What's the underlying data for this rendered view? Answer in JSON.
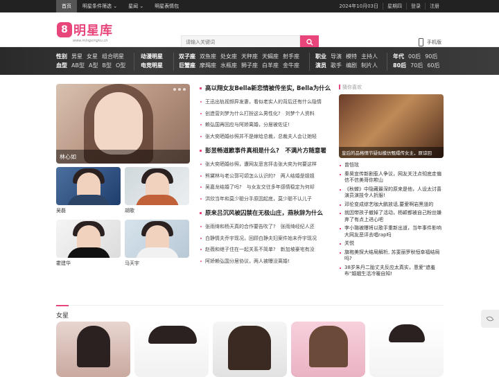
{
  "topbar": {
    "nav": [
      "首页",
      "明星条件筛选 ⌄",
      "星闻 ⌄",
      "明星表情包"
    ],
    "date": "2024年10月03日",
    "weekday": "星期四",
    "login": "登录",
    "register": "注册"
  },
  "header": {
    "logo_mark": "8",
    "logo_text": "明星库",
    "logo_url": "www.mingxingku.cn",
    "search_placeholder": "请输入关键词",
    "mobile_label": "手机版"
  },
  "categories": {
    "gender": {
      "label": "性别",
      "items": [
        "男星",
        "女星",
        "组合明星"
      ]
    },
    "blood": {
      "label": "血型",
      "items": [
        "AB型",
        "A型",
        "B型",
        "O型"
      ]
    },
    "anime": {
      "label": "动漫明星"
    },
    "esports": {
      "label": "电竞明星"
    },
    "zodiac": {
      "label1": "双子座",
      "items1": [
        "双鱼座",
        "处女座",
        "天秤座",
        "天蝎座",
        "射手座"
      ],
      "label2": "巨蟹座",
      "items2": [
        "摩羯座",
        "水瓶座",
        "狮子座",
        "白羊座",
        "金牛座"
      ]
    },
    "job": {
      "label": "职业",
      "items": [
        "导演",
        "模特",
        "主持人"
      ]
    },
    "actor": {
      "label": "演员",
      "items": [
        "歌手",
        "编剧",
        "制片人"
      ]
    },
    "era": {
      "label1": "年代",
      "items1": [
        "00后",
        "90后"
      ],
      "label2": "80后",
      "items2": [
        "70后",
        "60后"
      ]
    }
  },
  "featured": {
    "caption": "林心如"
  },
  "thumbs": [
    "吴磊",
    "胡歌",
    "霍建华",
    "马天宇"
  ],
  "news": [
    {
      "headline": "高以翔女友Bella新恋情被传坐实, Bella为什么",
      "items": [
        "王迅出轨视频异发妻，看似老实人的背后还有什么隐情",
        "创造营刘梦为什么打扮这么男性化?　刘梦个人资料",
        "赖弘国再回应与阿娇离婚，分居被佐证!",
        "张大奕晒婚纱照并不是嫁给总裁，总裁夫人会让她轻"
      ]
    },
    {
      "headline": "彭昱畅道歉事件真相是什么?　不满片方随意署",
      "items": [
        "张大奕晒婚纱照，遭网友恶言抨击张大奕为何要这样",
        "熊黛林与老公郭可颂怎么认识的?　两人结婚是姐姐",
        "吴嘉龙结婚了吗?　与女友交往多年感情稳定为何却",
        "洪欣当年和莫少聪分手原因起底，莫少聪不认儿子"
      ]
    },
    {
      "headline": "原来吕沉风被囚禁在无极山庄，燕秋辞为什么",
      "items": [
        "张雨绮和杨天真的合作要告吹了?　张雨绮经纪人还",
        "白静情夫乔宇现况，回顾白静夫妇案件始末乔宇现况",
        "赵薇和继子住在一起关系不简单?　新加坡豪宅有没",
        "阿娇赖弘国分居协议，两人被曝没离婚!"
      ]
    }
  ],
  "side": {
    "title": "猜你喜欢",
    "big_caption": "皇后的品格情节疑似模仿甄嬛传女主，原谅回",
    "items": [
      "曾恺玹",
      "秦昊宣传新剧惹人争议，网友关注点彻底走偏信不信美哥你欺山",
      "《秋蝉》中隐藏最深的原来是他，人设太讨喜演员演技令人折服!",
      "邓伦变成综艺咖大鹏放话,要爱啊岩黑道的",
      "就因带孩子撤掉了活动，杨颖都被自己粉丝嫌弃了有点上进心吧",
      "李小璐被曝将以歌手重新出道，当年事件影响大网友恶评去唱rap吗",
      "关悦",
      "旗袍美探大结局解析, 苏斐丽罗秋恒幸福结局吗?",
      "38岁朱丹二胎丈夫反应太真实，恩爱\"遮羞布\"婚姻生活冷暖自知!"
    ]
  },
  "female": {
    "title": "女星"
  }
}
